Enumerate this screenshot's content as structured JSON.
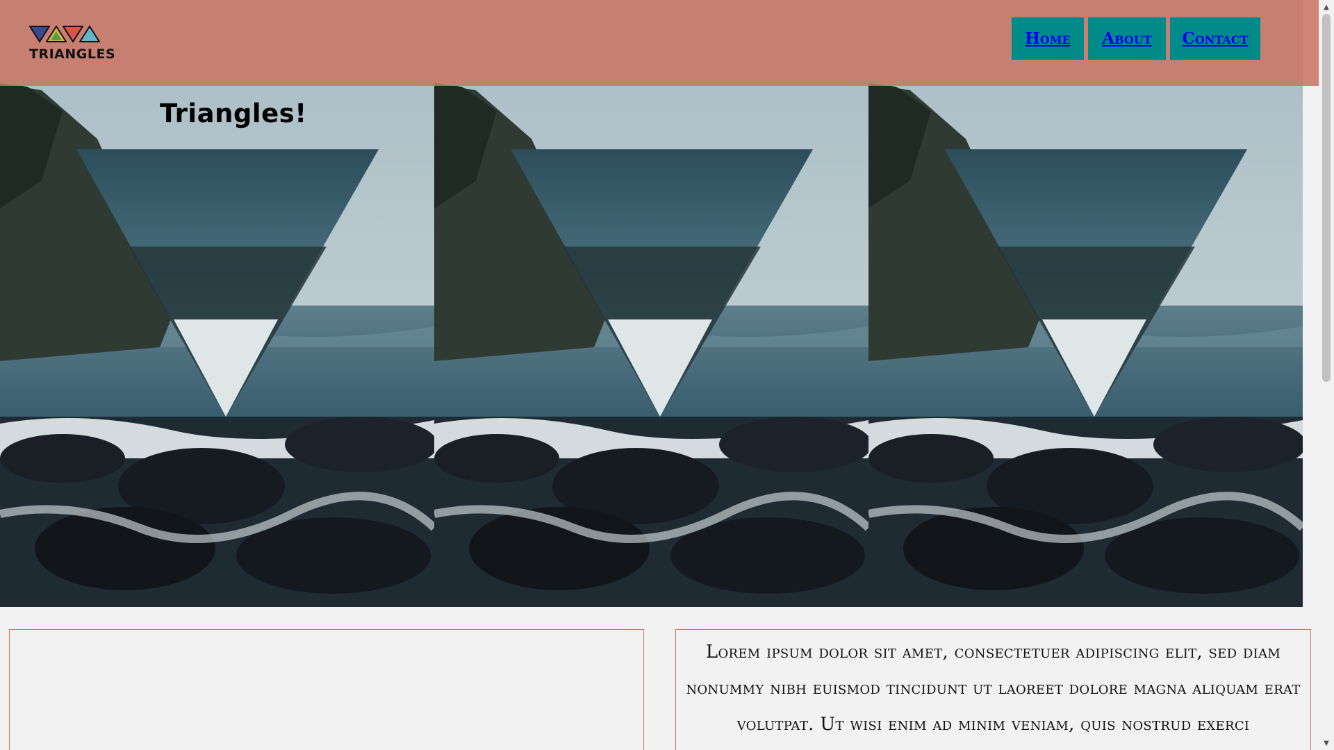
{
  "header": {
    "logo_text": "TRIANGLES",
    "logo_icon": "triangles-logo-icon",
    "background_color": "#cb7462"
  },
  "nav": {
    "items": [
      {
        "label": "Home"
      },
      {
        "label": "About"
      },
      {
        "label": "Contact"
      }
    ],
    "button_color": "#008b8b",
    "link_color": "#0000ee"
  },
  "hero": {
    "title": "Triangles!",
    "image": "ocean-rocks-inverted-triangle-image"
  },
  "content": {
    "right_text": "Lorem ipsum dolor sit amet, consectetuer adipiscing elit, sed diam nonummy nibh euismod tincidunt ut laoreet dolore magna aliquam erat volutpat. Ut wisi enim ad minim veniam, quis nostrud exerci",
    "border_color": "#cb7462"
  }
}
